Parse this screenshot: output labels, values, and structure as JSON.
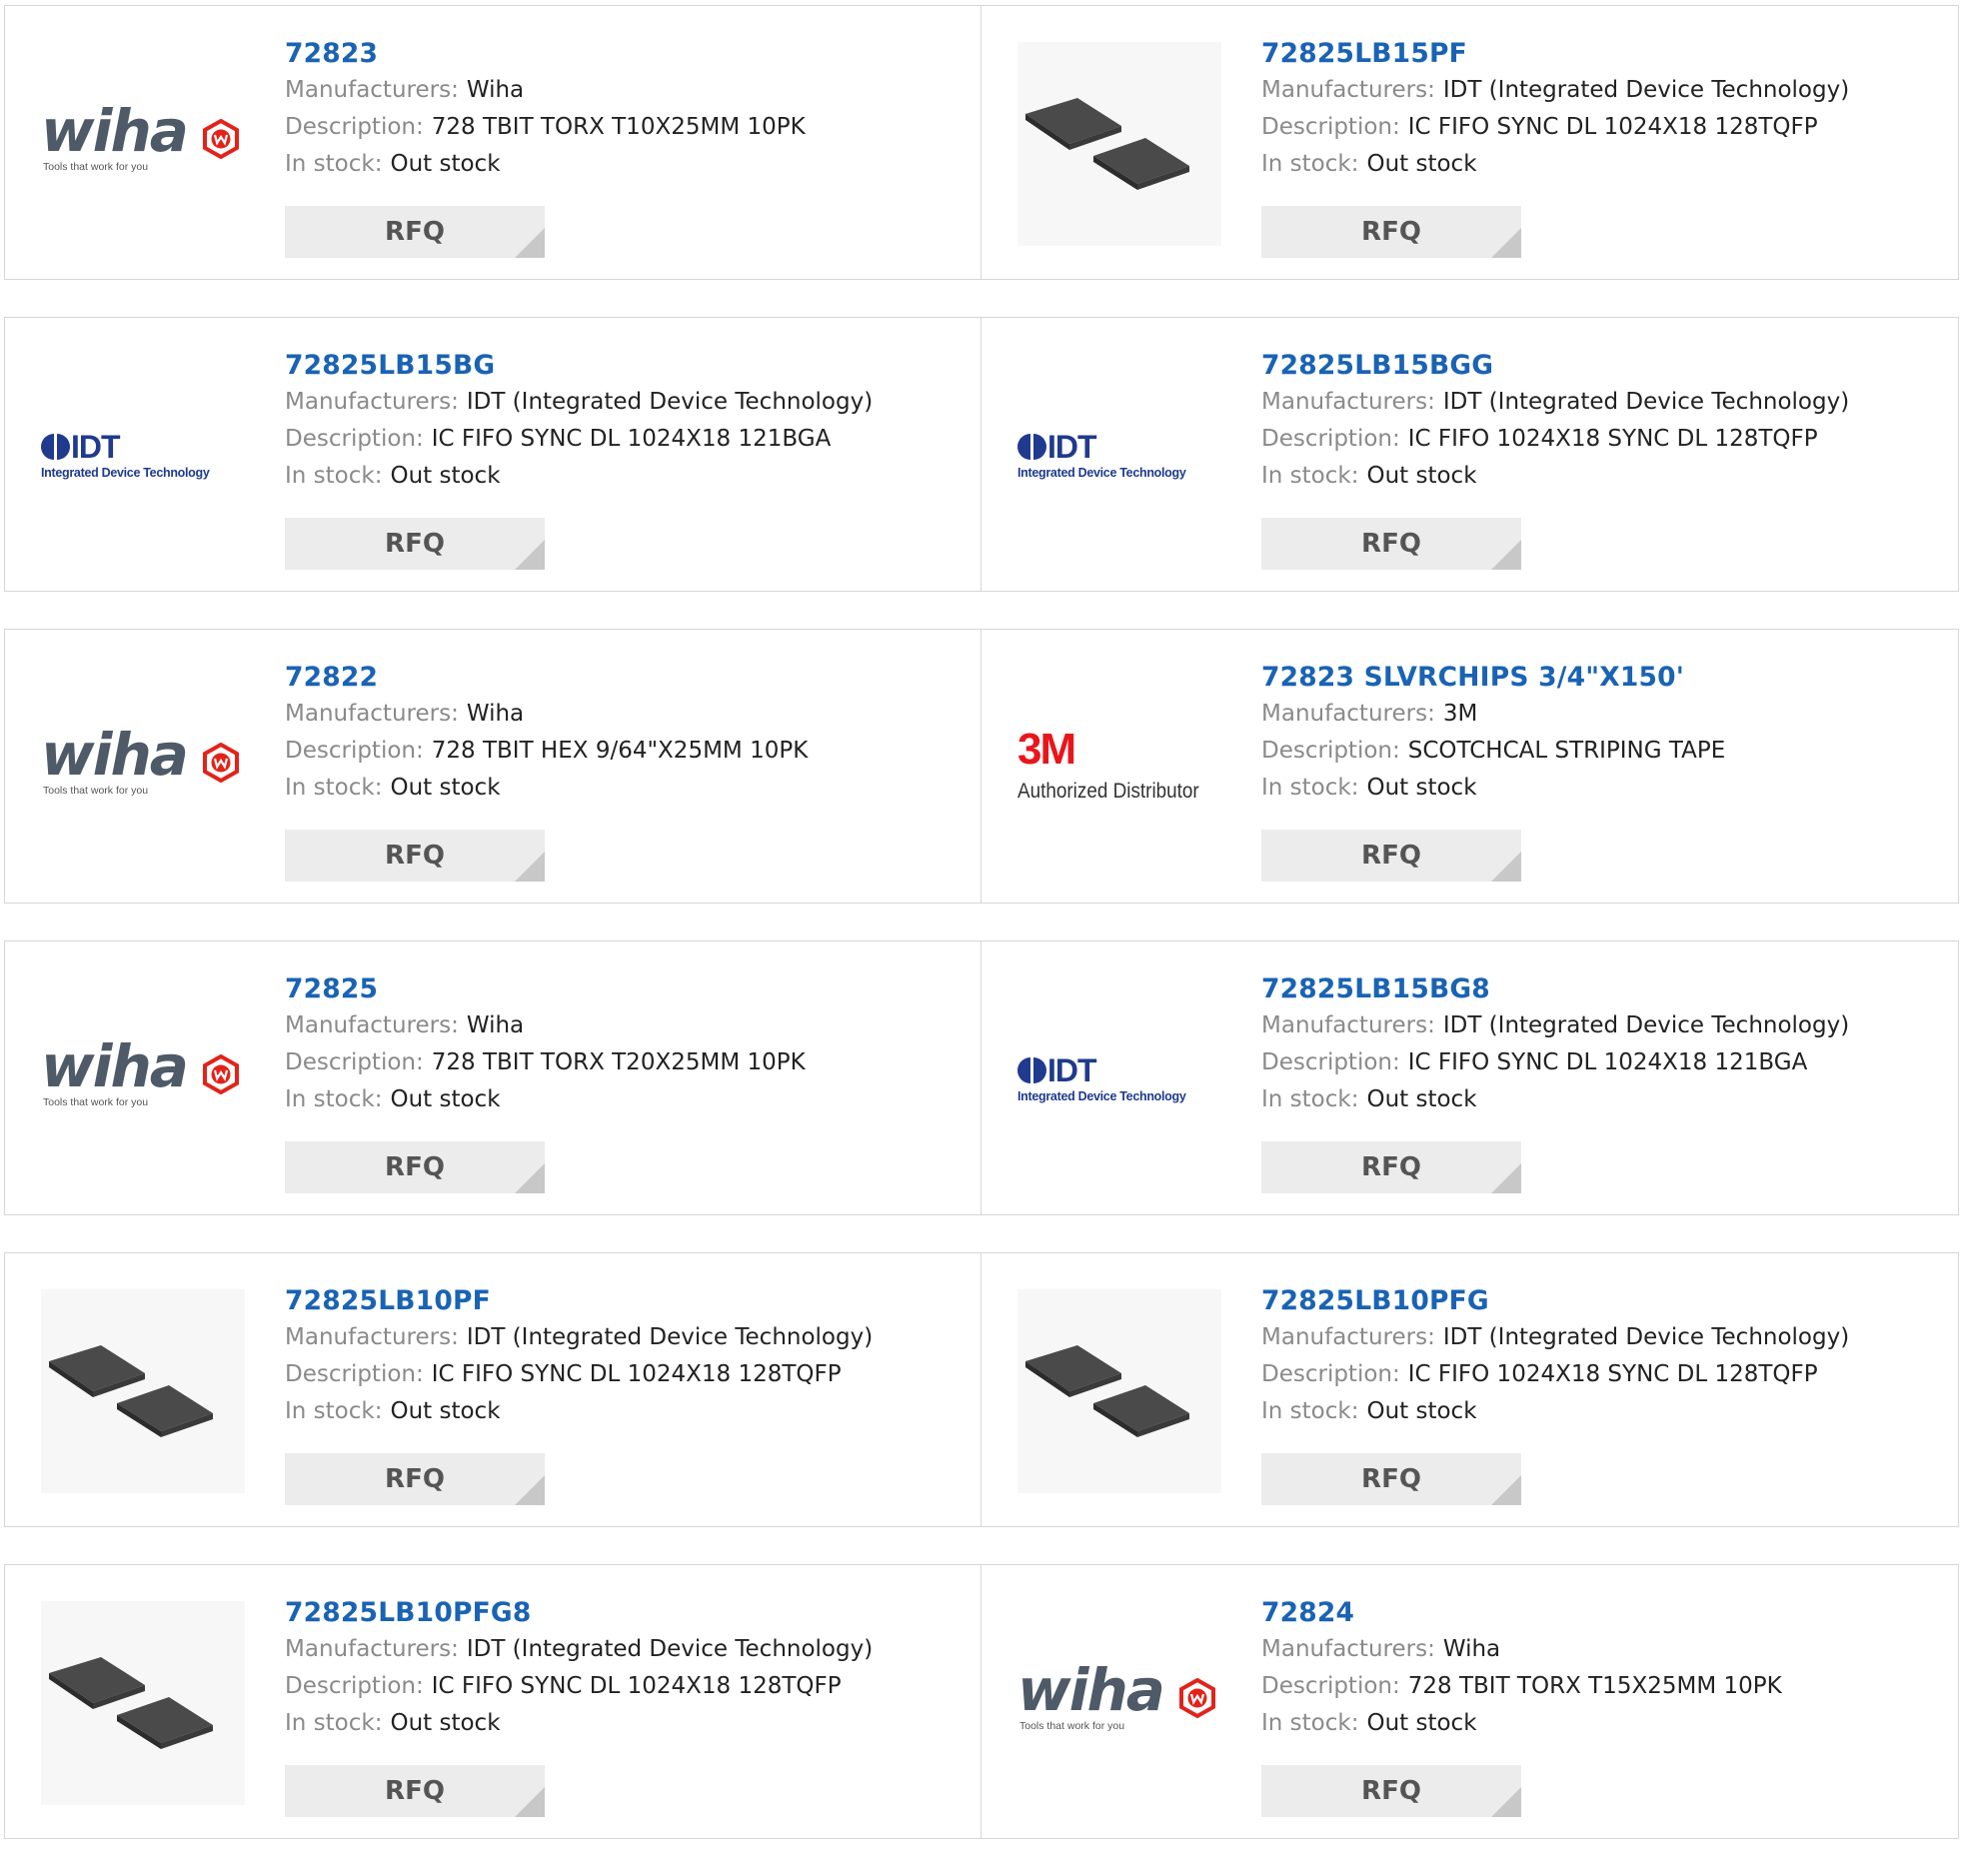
{
  "labels": {
    "manufacturers": "Manufacturers:",
    "description": "Description:",
    "stock": "In stock:",
    "rfq": "RFQ"
  },
  "logos": {
    "wiha": {
      "word": "wiha",
      "tagline": "Tools that work for you",
      "badge_color": "#e2231a"
    },
    "idt": {
      "word": "IDT",
      "tagline": "Integrated Device Technology",
      "color": "#1f3a8e"
    },
    "threem": {
      "word": "3M",
      "tagline": "Authorized Distributor",
      "color": "#e8161b"
    }
  },
  "colors": {
    "title": "#1a63b4",
    "label": "#8a8a8a",
    "button_bg": "#ececec"
  },
  "products": [
    {
      "part": "72823",
      "manufacturer": "Wiha",
      "description": "728 TBIT TORX T10X25MM 10PK",
      "stock": "Out stock",
      "image": "wiha-logo"
    },
    {
      "part": "72825LB15PF",
      "manufacturer": "IDT (Integrated Device Technology)",
      "description": "IC FIFO SYNC DL 1024X18 128TQFP",
      "stock": "Out stock",
      "image": "chip-photo"
    },
    {
      "part": "72825LB15BG",
      "manufacturer": "IDT (Integrated Device Technology)",
      "description": "IC FIFO SYNC DL 1024X18 121BGA",
      "stock": "Out stock",
      "image": "idt-logo"
    },
    {
      "part": "72825LB15BGG",
      "manufacturer": "IDT (Integrated Device Technology)",
      "description": "IC FIFO 1024X18 SYNC DL 128TQFP",
      "stock": "Out stock",
      "image": "idt-logo"
    },
    {
      "part": "72822",
      "manufacturer": "Wiha",
      "description": "728 TBIT HEX 9/64\"X25MM 10PK",
      "stock": "Out stock",
      "image": "wiha-logo"
    },
    {
      "part": "72823 SLVRCHIPS 3/4\"X150'",
      "manufacturer": "3M",
      "description": "SCOTCHCAL STRIPING TAPE",
      "stock": "Out stock",
      "image": "3m-logo"
    },
    {
      "part": "72825",
      "manufacturer": "Wiha",
      "description": "728 TBIT TORX T20X25MM 10PK",
      "stock": "Out stock",
      "image": "wiha-logo"
    },
    {
      "part": "72825LB15BG8",
      "manufacturer": "IDT (Integrated Device Technology)",
      "description": "IC FIFO SYNC DL 1024X18 121BGA",
      "stock": "Out stock",
      "image": "idt-logo"
    },
    {
      "part": "72825LB10PF",
      "manufacturer": "IDT (Integrated Device Technology)",
      "description": "IC FIFO SYNC DL 1024X18 128TQFP",
      "stock": "Out stock",
      "image": "chip-photo"
    },
    {
      "part": "72825LB10PFG",
      "manufacturer": "IDT (Integrated Device Technology)",
      "description": "IC FIFO 1024X18 SYNC DL 128TQFP",
      "stock": "Out stock",
      "image": "chip-photo"
    },
    {
      "part": "72825LB10PFG8",
      "manufacturer": "IDT (Integrated Device Technology)",
      "description": "IC FIFO SYNC DL 1024X18 128TQFP",
      "stock": "Out stock",
      "image": "chip-photo"
    },
    {
      "part": "72824",
      "manufacturer": "Wiha",
      "description": "728 TBIT TORX T15X25MM 10PK",
      "stock": "Out stock",
      "image": "wiha-logo"
    }
  ]
}
